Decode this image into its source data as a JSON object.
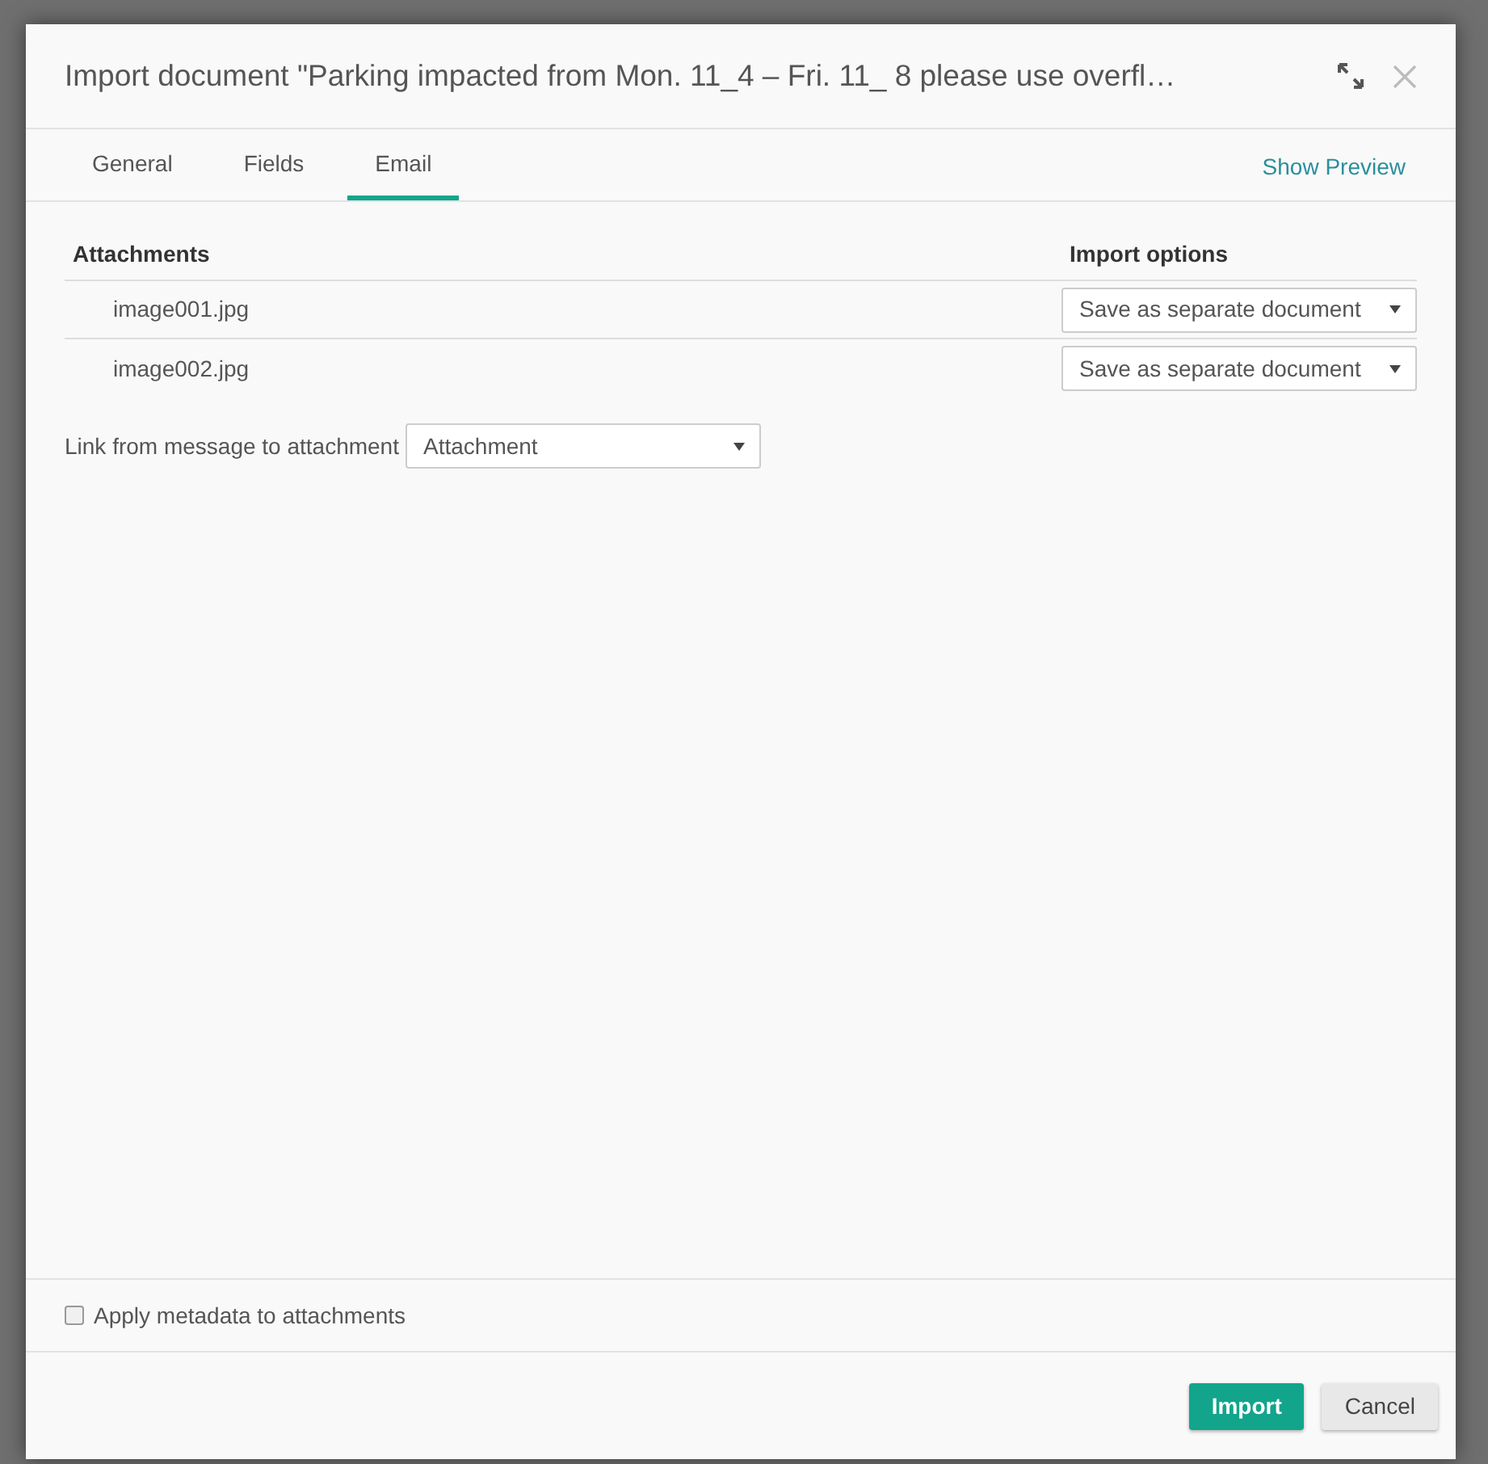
{
  "dialog": {
    "title": "Import document \"Parking impacted from Mon. 11_4 – Fri. 11_ 8 please use overfl…"
  },
  "tabs": [
    {
      "label": "General",
      "selected": false
    },
    {
      "label": "Fields",
      "selected": false
    },
    {
      "label": "Email",
      "selected": true
    }
  ],
  "show_preview": "Show Preview",
  "table": {
    "columns": [
      "Attachments",
      "Import options"
    ],
    "rows": [
      {
        "name": "image001.jpg",
        "option": "Save as separate document"
      },
      {
        "name": "image002.jpg",
        "option": "Save as separate document"
      }
    ]
  },
  "link_field": {
    "label": "Link from message to attachment",
    "value": "Attachment"
  },
  "apply_metadata": {
    "label": "Apply metadata to attachments",
    "checked": false
  },
  "buttons": [
    {
      "label": "Import",
      "kind": "primary"
    },
    {
      "label": "Cancel",
      "kind": "secondary"
    }
  ]
}
